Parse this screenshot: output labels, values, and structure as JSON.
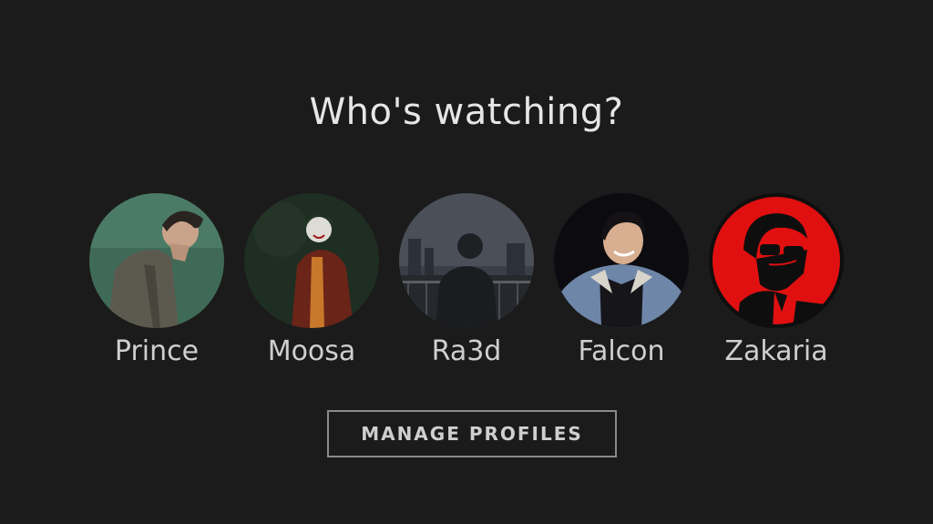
{
  "title": "Who's watching?",
  "profiles": [
    {
      "name": "Prince"
    },
    {
      "name": "Moosa"
    },
    {
      "name": "Ra3d"
    },
    {
      "name": "Falcon"
    },
    {
      "name": "Zakaria"
    }
  ],
  "manage_button": {
    "label": "MANAGE PROFILES"
  },
  "colors": {
    "background": "#1b1b1b",
    "text": "#e6e6e6",
    "button_border": "#8a8a8a",
    "zakaria_avatar_red": "#e01010"
  }
}
